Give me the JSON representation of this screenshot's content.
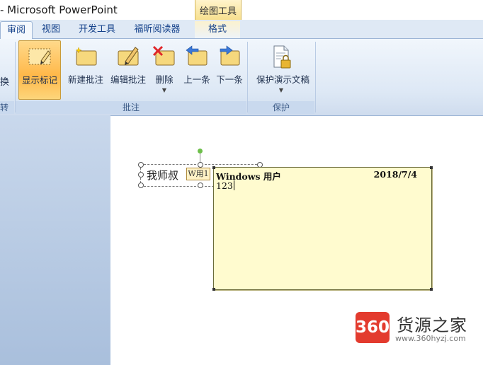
{
  "window": {
    "title": "- Microsoft PowerPoint",
    "context_tab_group": "绘图工具"
  },
  "tabs": [
    {
      "label": "审阅",
      "active": true
    },
    {
      "label": "视图"
    },
    {
      "label": "开发工具"
    },
    {
      "label": "福昕阅读器"
    },
    {
      "label": "格式",
      "context": true
    }
  ],
  "ribbon": {
    "left_partial": {
      "button_label": "换",
      "group_label": "转换"
    },
    "groups": [
      {
        "label": "批注",
        "buttons": [
          {
            "label": "显示标记",
            "icon": "show-markup-icon",
            "selected": true
          },
          {
            "label": "新建批注",
            "icon": "new-comment-icon"
          },
          {
            "label": "编辑批注",
            "icon": "edit-comment-icon"
          },
          {
            "label": "删除",
            "icon": "delete-comment-icon",
            "has_dropdown": true
          },
          {
            "label": "上一条",
            "icon": "previous-comment-icon"
          },
          {
            "label": "下一条",
            "icon": "next-comment-icon"
          }
        ]
      },
      {
        "label": "保护",
        "buttons": [
          {
            "label": "保护演示文稿",
            "icon": "protect-presentation-icon",
            "has_dropdown": true
          }
        ]
      }
    ]
  },
  "slide": {
    "textbox_text": "我师叔",
    "comment_marker": "W用1",
    "comment": {
      "author": "Windows 用户",
      "date": "2018/7/4",
      "body": "123"
    }
  },
  "watermark": {
    "badge": "360",
    "text": "货源之家",
    "url": "www.360hyzj.com"
  },
  "colors": {
    "comment_bg": "#fffbcf",
    "selected_button": "#ffb849",
    "ribbon_text": "#15428b",
    "badge": "#e33b2e"
  }
}
